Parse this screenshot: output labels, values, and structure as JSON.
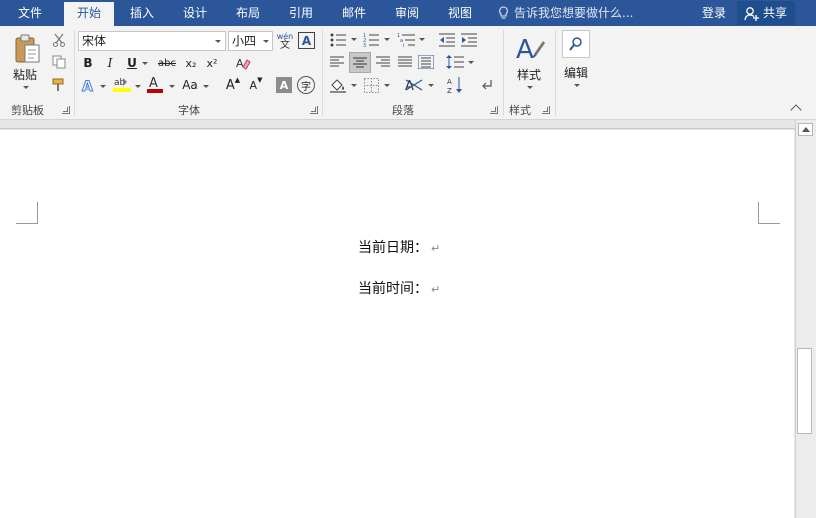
{
  "tabs": [
    {
      "label": "文件"
    },
    {
      "label": "开始"
    },
    {
      "label": "插入"
    },
    {
      "label": "设计"
    },
    {
      "label": "布局"
    },
    {
      "label": "引用"
    },
    {
      "label": "邮件"
    },
    {
      "label": "审阅"
    },
    {
      "label": "视图"
    }
  ],
  "active_tab": "开始",
  "tell_me": "告诉我您想要做什么...",
  "login": "登录",
  "share": "共享",
  "colors": {
    "brand": "#2b579a",
    "highlight": "#ffff00",
    "font_color": "#c00000"
  },
  "ribbon": {
    "clipboard": {
      "label": "剪贴板",
      "paste": "粘贴"
    },
    "font": {
      "label": "字体",
      "name": "宋体",
      "size": "小四",
      "phonetic_top": "wén",
      "phonetic_bottom": "文",
      "bold": "B",
      "italic": "I",
      "underline": "U",
      "strike": "abc",
      "sub": "x₂",
      "sup": "x²",
      "change_case": "Aa",
      "grow": "A",
      "shrink": "A",
      "enclosed": "字"
    },
    "paragraph": {
      "label": "段落"
    },
    "styles": {
      "label": "样式",
      "button": "样式"
    },
    "editing": {
      "button": "编辑"
    }
  },
  "document": {
    "lines": [
      "当前日期：",
      "当前时间："
    ],
    "pilcrow": "↵"
  }
}
